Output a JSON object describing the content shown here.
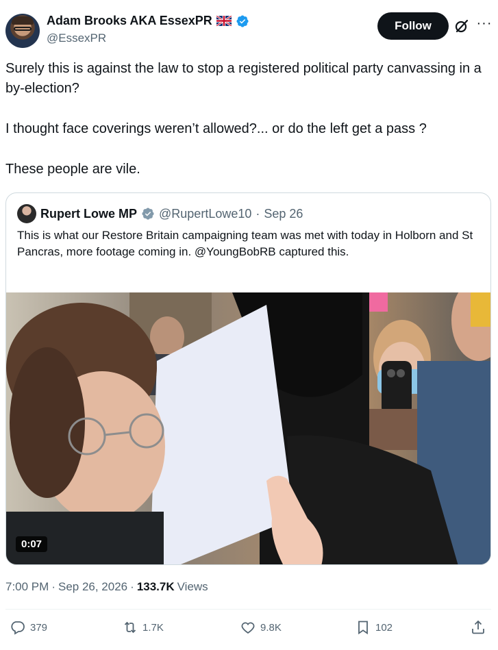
{
  "author": {
    "display_name": "Adam Brooks AKA EssexPR",
    "handle": "@EssexPR",
    "follow_label": "Follow"
  },
  "tweet": {
    "paragraphs": [
      "Surely this is against the law to stop a registered political party canvassing in a by-election?",
      "I thought face coverings weren’t allowed?... or do the left get a pass ?",
      "These people are vile."
    ]
  },
  "quote": {
    "display_name": "Rupert Lowe MP",
    "handle": "@RupertLowe10",
    "separator": "·",
    "date": "Sep 26",
    "text": "This is what our Restore Britain campaigning team was met with today in Holborn and St Pancras, more footage coming in. @YoungBobRB captured this.",
    "video_duration": "0:07"
  },
  "meta": {
    "time": "7:00 PM",
    "sep1": "·",
    "date": "Sep 26, 2026",
    "sep2": "·",
    "views_count": "133.7K",
    "views_label": "Views"
  },
  "actions": {
    "replies": "379",
    "reposts": "1.7K",
    "likes": "9.8K",
    "bookmarks": "102"
  },
  "icons": [
    "verified-badge-icon",
    "uk-flag-icon",
    "grok-icon",
    "more-icon",
    "reply-icon",
    "repost-icon",
    "like-icon",
    "bookmark-icon",
    "share-icon"
  ],
  "colors": {
    "text": "#0f1419",
    "secondary": "#536471",
    "verified_blue": "#1d9bf0",
    "verified_gray": "#829aab",
    "follow_bg": "#0f1419",
    "border": "#cfd9de"
  }
}
